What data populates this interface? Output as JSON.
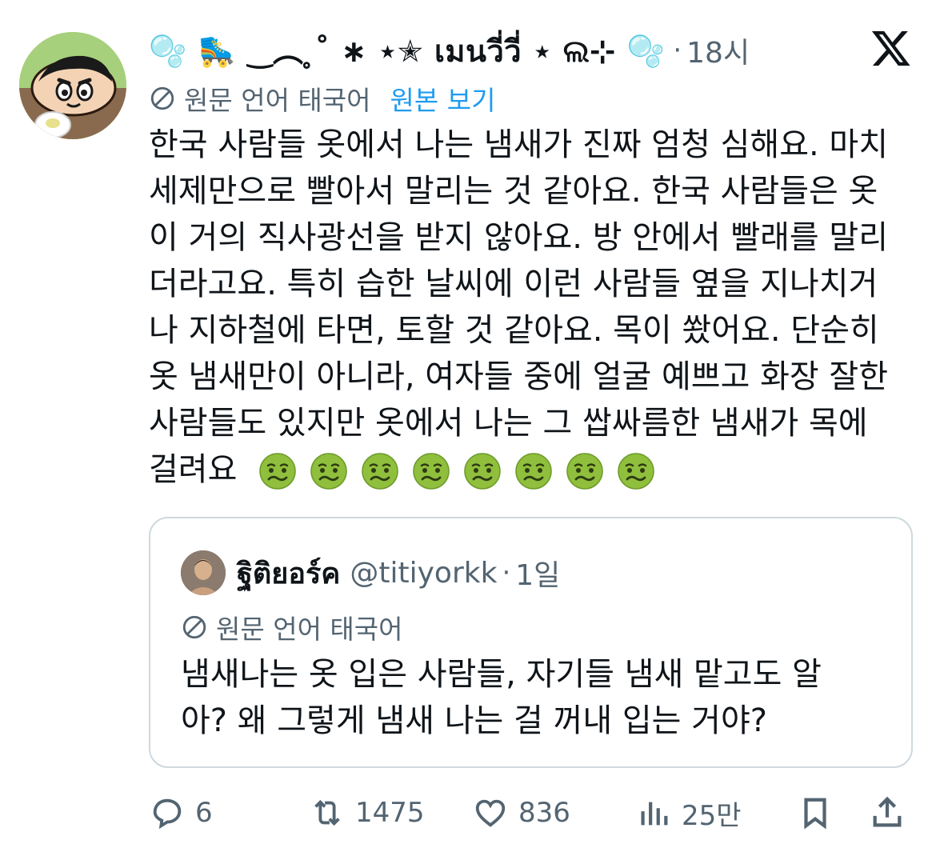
{
  "post": {
    "author_display_name": "🫧 🛼 ‿︵ ̥˚ ∗ ⋆✭ เมนวี่วี่ ⋆ ଲ⊹ 🫧",
    "time": "18시",
    "translation": {
      "label": "원문 언어 태국어",
      "show_original": "원본 보기"
    },
    "text_lines": [
      "한국 사람들 옷에서 나는 냄새가 진짜 엄청 심해요. 마치",
      "세제만으로 빨아서 말리는 것 같아요. 한국 사람들은 옷",
      "이 거의 직사광선을 받지 않아요. 방 안에서 빨래를 말리",
      "더라고요. 특히 습한 날씨에 이런 사람들 옆을 지나치거",
      "나 지하철에 타면, 토할 것 같아요. 목이 쐈어요. 단순히",
      "옷 냄새만이 아니라, 여자들 중에 얼굴 예쁘고 화장 잘한",
      "사람들도 있지만 옷에서 나는 그 쌉싸름한 냄새가 목에"
    ],
    "last_line": "걸려요",
    "emoji_count": 8,
    "emoji_name": "nauseated-face-emoji"
  },
  "quote": {
    "name": "ฐิติยอร์ค",
    "handle": "@titiyorkk",
    "time": "1일",
    "translation_label": "원문 언어 태국어",
    "text_lines": [
      "냄새나는 옷 입은 사람들, 자기들 냄새 맡고도 알",
      "아? 왜 그렇게 냄새 나는 걸 꺼내 입는 거야?"
    ]
  },
  "actions": {
    "replies": "6",
    "reposts": "1475",
    "likes": "836",
    "views": "25만"
  },
  "colors": {
    "text": "#0f1419",
    "secondary": "#536471",
    "link": "#1d9bf0",
    "border": "#cfd9de"
  }
}
